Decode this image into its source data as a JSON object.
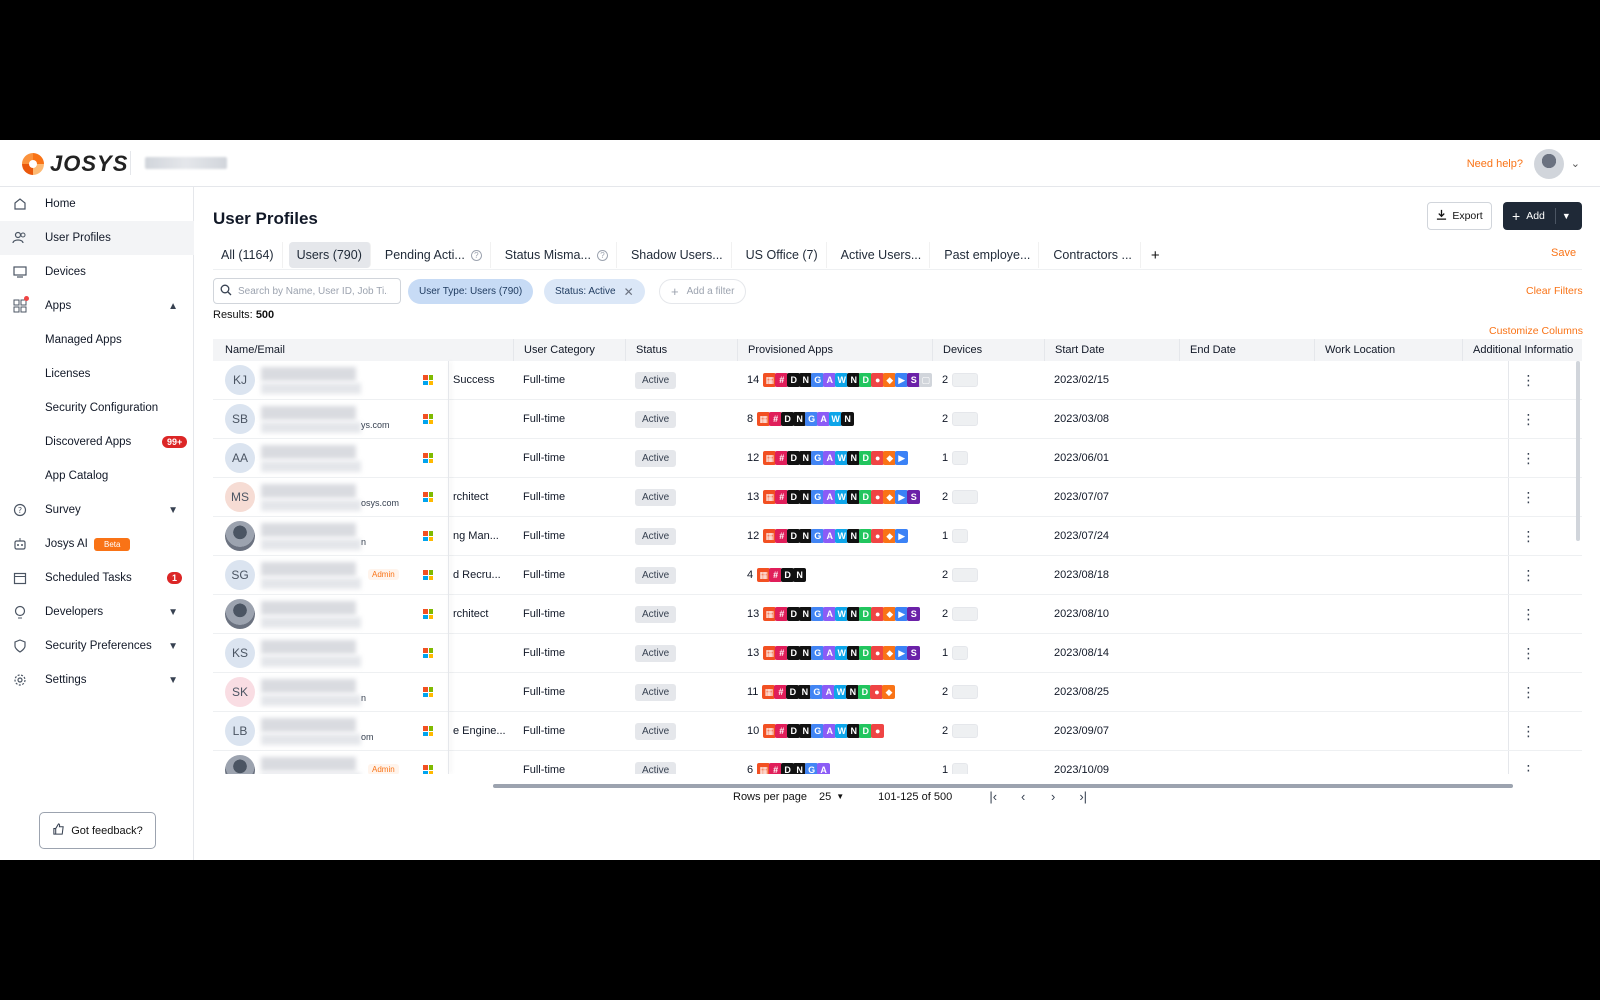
{
  "header": {
    "logo_text": "JOSYS",
    "help_label": "Need help?"
  },
  "sidebar": {
    "items": [
      {
        "label": "Home",
        "icon": "home-icon"
      },
      {
        "label": "User Profiles",
        "icon": "users-icon"
      },
      {
        "label": "Devices",
        "icon": "monitor-icon"
      },
      {
        "label": "Apps",
        "icon": "grid-icon"
      },
      {
        "label": "Managed Apps"
      },
      {
        "label": "Licenses"
      },
      {
        "label": "Security Configuration"
      },
      {
        "label": "Discovered Apps",
        "badge": "99+"
      },
      {
        "label": "App Catalog"
      },
      {
        "label": "Survey",
        "icon": "question-icon"
      },
      {
        "label": "Josys AI",
        "icon": "robot-icon",
        "badge": "Beta"
      },
      {
        "label": "Scheduled Tasks",
        "icon": "calendar-icon",
        "badge": "1"
      },
      {
        "label": "Developers",
        "icon": "developer-icon"
      },
      {
        "label": "Security Preferences",
        "icon": "shield-icon"
      },
      {
        "label": "Settings",
        "icon": "gear-icon"
      }
    ],
    "feedback_label": "Got feedback?"
  },
  "main": {
    "title": "User Profiles",
    "export_label": "Export",
    "add_label": "Add",
    "save_label": "Save",
    "tabs": [
      {
        "label": "All (1164)"
      },
      {
        "label": "Users (790)"
      },
      {
        "label": "Pending Acti..."
      },
      {
        "label": "Status Misma..."
      },
      {
        "label": "Shadow Users..."
      },
      {
        "label": "US Office (7)"
      },
      {
        "label": "Active Users..."
      },
      {
        "label": "Past employe..."
      },
      {
        "label": "Contractors ..."
      }
    ],
    "search_placeholder": "Search by Name, User ID, Job Ti...",
    "filters": {
      "user_type": "User Type: Users (790)",
      "status": "Status: Active",
      "add_filter": "Add a filter"
    },
    "clear_filters": "Clear Filters",
    "results_label": "Results:",
    "results_count": "500",
    "customize_columns": "Customize Columns"
  },
  "table": {
    "columns": [
      "Name/Email",
      "User Category",
      "Status",
      "Provisioned Apps",
      "Devices",
      "Start Date",
      "End Date",
      "Work Location",
      "Additional Informatio"
    ],
    "rows": [
      {
        "initials": "KJ",
        "avatar_color": "#dbe4f0",
        "email_tail": "",
        "admin": false,
        "job": "Success",
        "category": "Full-time",
        "status": "Active",
        "apps": "14",
        "devices": "2",
        "start": "2023/02/15"
      },
      {
        "initials": "SB",
        "avatar_color": "#dbe4f0",
        "email_tail": "ys.com",
        "admin": false,
        "job": "",
        "category": "Full-time",
        "status": "Active",
        "apps": "8",
        "devices": "2",
        "start": "2023/03/08"
      },
      {
        "initials": "AA",
        "avatar_color": "#dbe4f0",
        "email_tail": "",
        "admin": false,
        "job": "",
        "category": "Full-time",
        "status": "Active",
        "apps": "12",
        "devices": "1",
        "start": "2023/06/01"
      },
      {
        "initials": "MS",
        "avatar_color": "#f6dcd4",
        "email_tail": "osys.com",
        "admin": false,
        "job": "rchitect",
        "category": "Full-time",
        "status": "Active",
        "apps": "13",
        "devices": "2",
        "start": "2023/07/07"
      },
      {
        "initials": "",
        "avatar_color": "photo",
        "email_tail": "n",
        "admin": false,
        "job": "ng Man...",
        "category": "Full-time",
        "status": "Active",
        "apps": "12",
        "devices": "1",
        "start": "2023/07/24"
      },
      {
        "initials": "SG",
        "avatar_color": "#dbe4f0",
        "email_tail": "",
        "admin": true,
        "job": "d Recru...",
        "category": "Full-time",
        "status": "Active",
        "apps": "4",
        "devices": "2",
        "start": "2023/08/18"
      },
      {
        "initials": "",
        "avatar_color": "photo2",
        "email_tail": "",
        "admin": false,
        "job": "rchitect",
        "category": "Full-time",
        "status": "Active",
        "apps": "13",
        "devices": "2",
        "start": "2023/08/10"
      },
      {
        "initials": "KS",
        "avatar_color": "#dbe4f0",
        "email_tail": "",
        "admin": false,
        "job": "",
        "category": "Full-time",
        "status": "Active",
        "apps": "13",
        "devices": "1",
        "start": "2023/08/14"
      },
      {
        "initials": "SK",
        "avatar_color": "#f9dde3",
        "email_tail": "n",
        "admin": false,
        "job": "",
        "category": "Full-time",
        "status": "Active",
        "apps": "11",
        "devices": "2",
        "start": "2023/08/25"
      },
      {
        "initials": "LB",
        "avatar_color": "#dbe4f0",
        "email_tail": "om",
        "admin": false,
        "job": "e Engine...",
        "category": "Full-time",
        "status": "Active",
        "apps": "10",
        "devices": "2",
        "start": "2023/09/07"
      },
      {
        "initials": "",
        "avatar_color": "photo3",
        "email_tail": "",
        "admin": true,
        "job": "",
        "category": "Full-time",
        "status": "Active",
        "apps": "6",
        "devices": "1",
        "start": "2023/10/09"
      }
    ],
    "admin_label": "Admin"
  },
  "pagination": {
    "rows_per_page_label": "Rows per page",
    "rows_per_page": "25",
    "range": "101-125 of 500"
  },
  "colors": {
    "accent": "#f97316",
    "primary_button": "#1f2937",
    "chip": "#c7dbf5"
  }
}
